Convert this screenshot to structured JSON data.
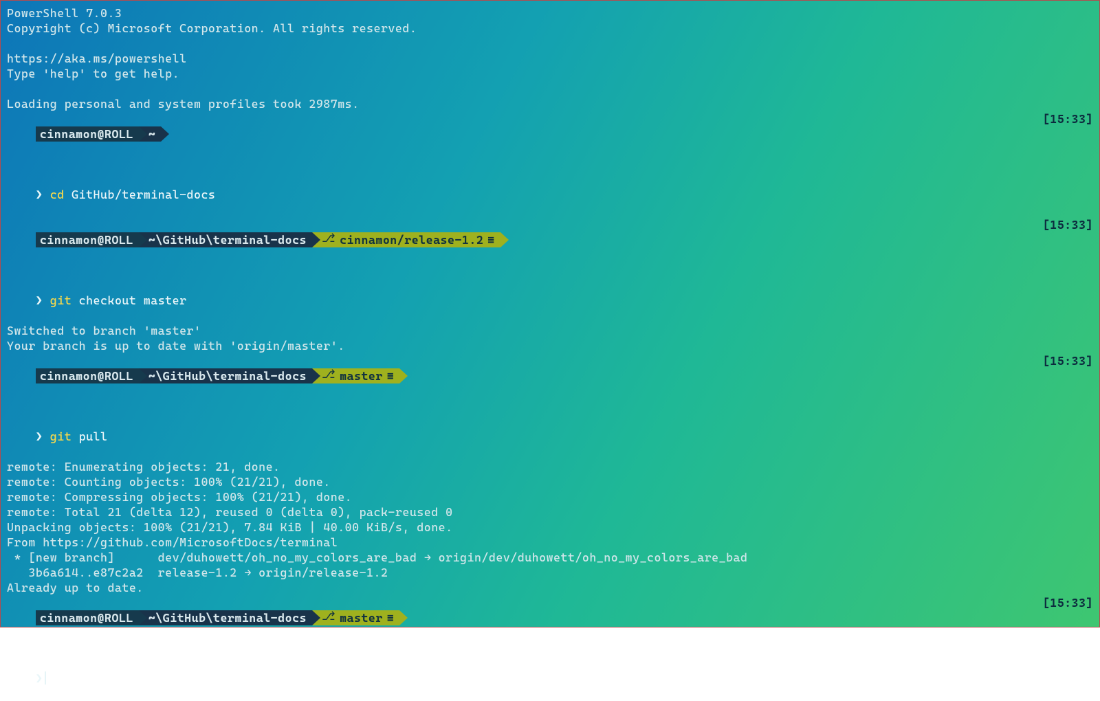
{
  "header": {
    "line1": "PowerShell 7.0.3",
    "line2": "Copyright (c) Microsoft Corporation. All rights reserved.",
    "line3": "https://aka.ms/powershell",
    "line4": "Type 'help' to get help.",
    "line5": "Loading personal and system profiles took 2987ms."
  },
  "user": "cinnamon@ROLL",
  "paths": {
    "home": "~",
    "repo": "~\\GitHub\\terminal-docs"
  },
  "branches": {
    "release": "cinnamon/release-1.2",
    "master": "master"
  },
  "timestamp": "[15:33]",
  "promptSym": "❯",
  "cmds": {
    "cd_cmd": "cd",
    "cd_arg": " GitHub/terminal-docs",
    "git1_cmd": "git",
    "git1_arg": " checkout master",
    "git2_cmd": "git",
    "git2_arg": " pull"
  },
  "out": {
    "sw1": "Switched to branch 'master'",
    "sw2": "Your branch is up to date with 'origin/master'.",
    "p1": "remote: Enumerating objects: 21, done.",
    "p2": "remote: Counting objects: 100% (21/21), done.",
    "p3": "remote: Compressing objects: 100% (21/21), done.",
    "p4": "remote: Total 21 (delta 12), reused 0 (delta 0), pack-reused 0",
    "p5": "Unpacking objects: 100% (21/21), 7.84 KiB | 40.00 KiB/s, done.",
    "p6": "From https://github.com/MicrosoftDocs/terminal",
    "p7": " * [new branch]      dev/duhowett/oh_no_my_colors_are_bad → origin/dev/duhowett/oh_no_my_colors_are_bad",
    "p8": "   3b6a614..e87c2a2  release-1.2 → origin/release-1.2",
    "p9": "Already up to date."
  }
}
